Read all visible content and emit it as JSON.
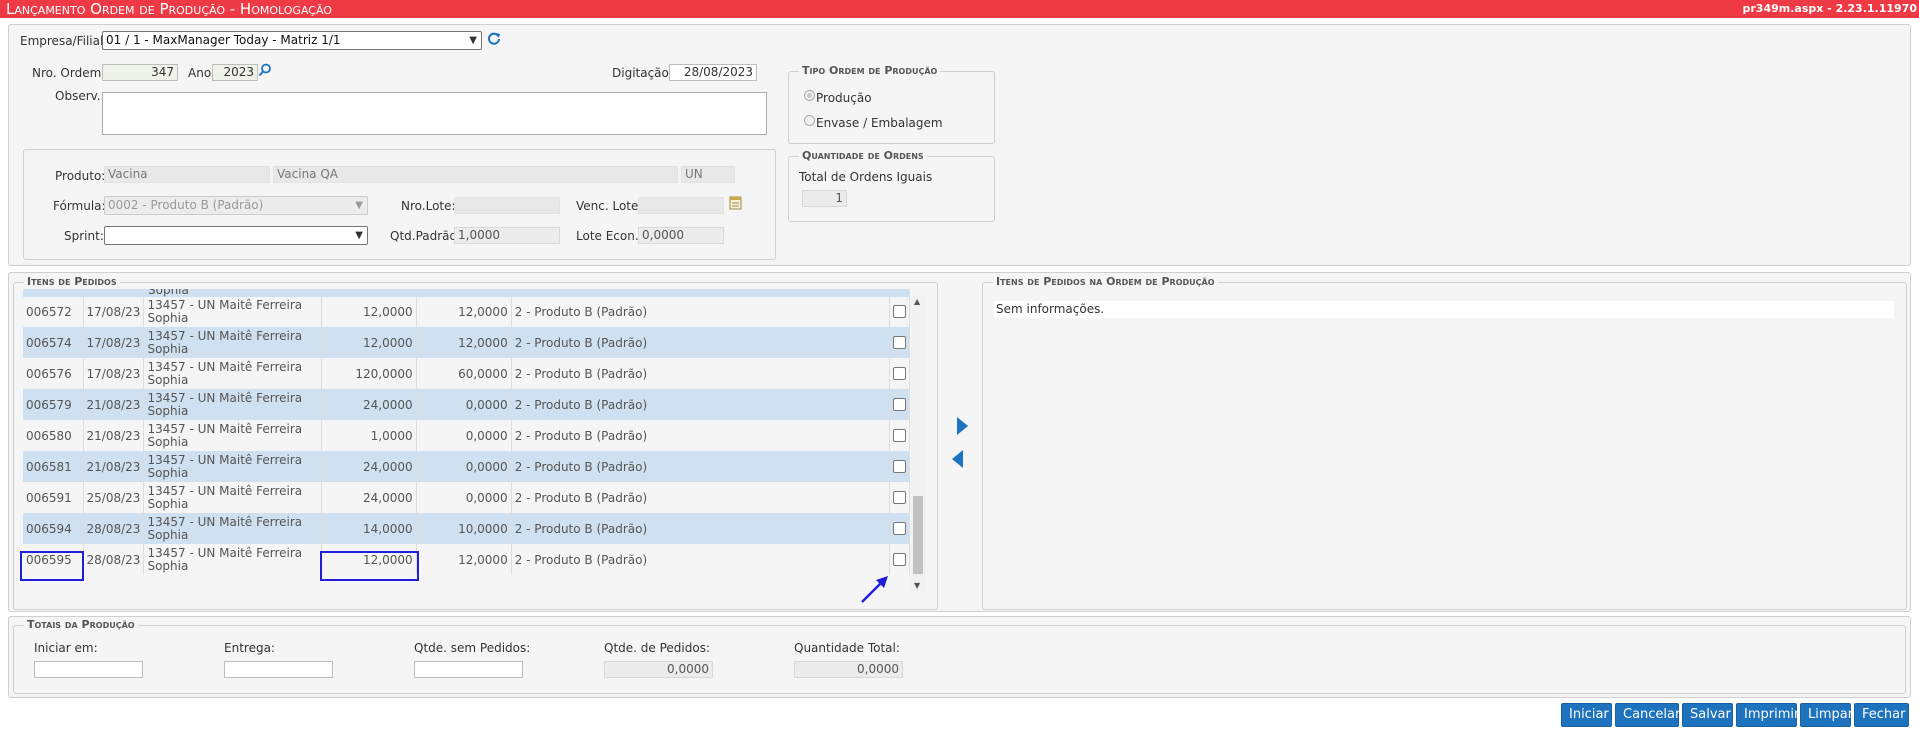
{
  "header": {
    "title": "Lançamento Ordem de Produção  - Homologação",
    "version": "pr349m.aspx - 2.23.1.11970"
  },
  "form": {
    "empresa_label": "Empresa/Filial:",
    "empresa_value": "01 / 1 - MaxManager Today - Matriz 1/1",
    "nro_ordem_label": "Nro. Ordem:",
    "nro_ordem_value": "347",
    "ano_label": "Ano:",
    "ano_value": "2023",
    "digitacao_label": "Digitação:",
    "digitacao_value": "28/08/2023",
    "observ_label": "Observ.:"
  },
  "tipo_ordem": {
    "legend": "Tipo Ordem de Produção",
    "option_producao": "Produção",
    "option_envase": "Envase / Embalagem"
  },
  "quantidade_ordens": {
    "legend": "Quantidade de Ordens",
    "total_label": "Total de Ordens Iguais",
    "total_value": "1"
  },
  "produto": {
    "produto_label": "Produto:",
    "produto_code": "Vacina",
    "produto_desc": "Vacina QA",
    "produto_unit": "UN",
    "formula_label": "Fórmula:",
    "formula_value": "0002 - Produto B (Padrão)",
    "nro_lote_label": "Nro.Lote:",
    "venc_lote_label": "Venc. Lote:",
    "sprint_label": "Sprint:",
    "qtd_padrao_label": "Qtd.Padrão:",
    "qtd_padrao_value": "1,0000",
    "lote_econ_label": "Lote Econ.:",
    "lote_econ_value": "0,0000"
  },
  "itens_pedidos": {
    "legend": "Itens de Pedidos",
    "partial_top_text": "Sophia",
    "rows": [
      {
        "pedido": "006572",
        "data": "17/08/23",
        "cliente": "13457 - UN Maitê Ferreira Sophia",
        "qtd": "12,0000",
        "saldo": "12,0000",
        "formula": "2 - Produto B (Padrão)"
      },
      {
        "pedido": "006574",
        "data": "17/08/23",
        "cliente": "13457 - UN Maitê Ferreira Sophia",
        "qtd": "12,0000",
        "saldo": "12,0000",
        "formula": "2 - Produto B (Padrão)"
      },
      {
        "pedido": "006576",
        "data": "17/08/23",
        "cliente": "13457 - UN Maitê Ferreira Sophia",
        "qtd": "120,0000",
        "saldo": "60,0000",
        "formula": "2 - Produto B (Padrão)"
      },
      {
        "pedido": "006579",
        "data": "21/08/23",
        "cliente": "13457 - UN Maitê Ferreira Sophia",
        "qtd": "24,0000",
        "saldo": "0,0000",
        "formula": "2 - Produto B (Padrão)"
      },
      {
        "pedido": "006580",
        "data": "21/08/23",
        "cliente": "13457 - UN Maitê Ferreira Sophia",
        "qtd": "1,0000",
        "saldo": "0,0000",
        "formula": "2 - Produto B (Padrão)"
      },
      {
        "pedido": "006581",
        "data": "21/08/23",
        "cliente": "13457 - UN Maitê Ferreira Sophia",
        "qtd": "24,0000",
        "saldo": "0,0000",
        "formula": "2 - Produto B (Padrão)"
      },
      {
        "pedido": "006591",
        "data": "25/08/23",
        "cliente": "13457 - UN Maitê Ferreira Sophia",
        "qtd": "24,0000",
        "saldo": "0,0000",
        "formula": "2 - Produto B (Padrão)"
      },
      {
        "pedido": "006594",
        "data": "28/08/23",
        "cliente": "13457 - UN Maitê Ferreira Sophia",
        "qtd": "14,0000",
        "saldo": "10,0000",
        "formula": "2 - Produto B (Padrão)"
      },
      {
        "pedido": "006595",
        "data": "28/08/23",
        "cliente": "13457 - UN Maitê Ferreira Sophia",
        "qtd": "12,0000",
        "saldo": "12,0000",
        "formula": "2 - Produto B (Padrão)"
      }
    ]
  },
  "itens_ordem": {
    "legend": "Itens de Pedidos na Ordem de Produção",
    "empty_text": "Sem informações."
  },
  "totais": {
    "legend": "Totais da Produção",
    "iniciar_label": "Iniciar em:",
    "entrega_label": "Entrega:",
    "qtde_sem_label": "Qtde. sem Pedidos:",
    "qtde_ped_label": "Qtde. de Pedidos:",
    "qtde_ped_value": "0,0000",
    "qtd_total_label": "Quantidade Total:",
    "qtd_total_value": "0,0000"
  },
  "buttons": {
    "iniciar": "Iniciar",
    "cancelar": "Cancelar",
    "salvar": "Salvar",
    "imprimir": "Imprimir",
    "limpar": "Limpar",
    "fechar": "Fechar"
  },
  "colors": {
    "title_bar": "#ef3a46",
    "button": "#1e73be",
    "row_alt": "#cfe1f1",
    "highlight": "#1f1fd8"
  }
}
